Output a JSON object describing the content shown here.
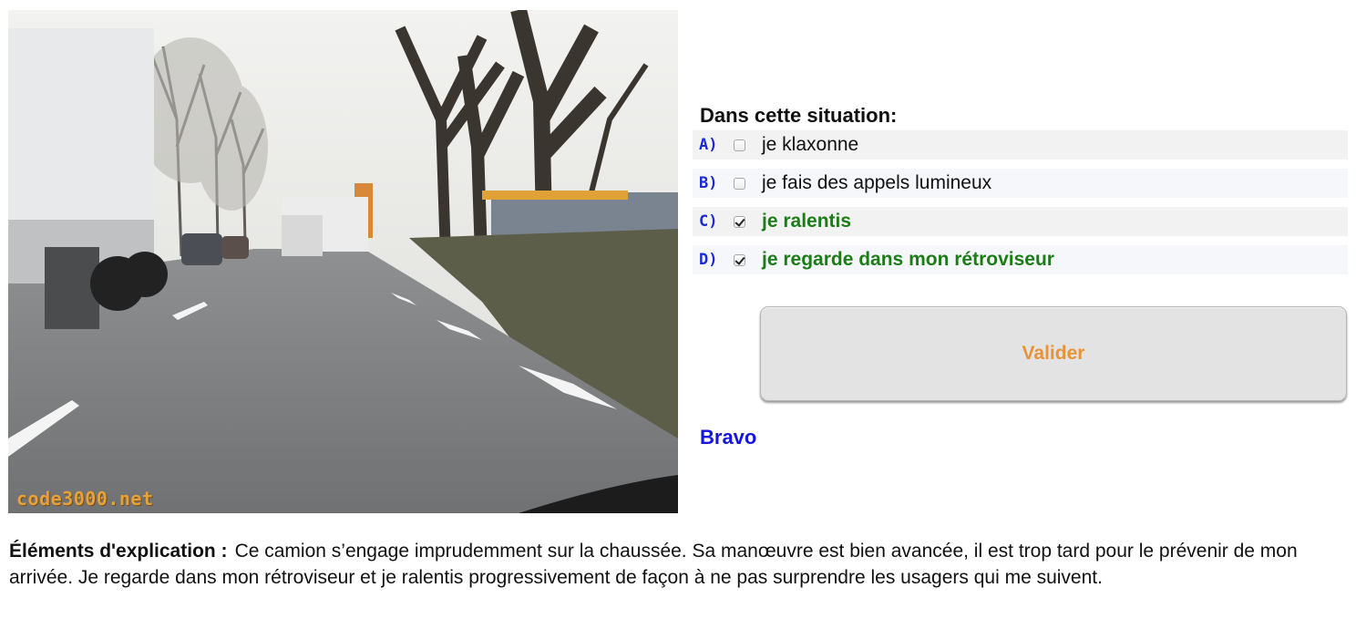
{
  "image": {
    "watermark": "code3000.net",
    "description_icon": "road-scene-photo"
  },
  "quiz": {
    "prompt": "Dans cette situation:",
    "answers": [
      {
        "letter": "A)",
        "text": "je klaxonne",
        "checked": false,
        "correct": false
      },
      {
        "letter": "B)",
        "text": "je fais des appels lumineux",
        "checked": false,
        "correct": false
      },
      {
        "letter": "C)",
        "text": "je ralentis",
        "checked": true,
        "correct": true
      },
      {
        "letter": "D)",
        "text": "je regarde dans mon rétroviseur",
        "checked": true,
        "correct": true
      }
    ],
    "validate_label": "Valider",
    "result": "Bravo"
  },
  "explanation": {
    "label": "Éléments d'explication :",
    "text": "Ce camion s’engage imprudemment sur la chaussée. Sa manœuvre est bien avancée, il est trop tard pour le prévenir de mon arrivée. Je regarde dans mon rétroviseur et je ralentis progressivement de façon à ne pas surprendre les usagers qui me suivent."
  },
  "colors": {
    "letter": "#1a2bd6",
    "correct": "#1b7d16",
    "validate_text": "#e8923a",
    "bravo": "#1515dd",
    "watermark": "#e3a23a"
  }
}
